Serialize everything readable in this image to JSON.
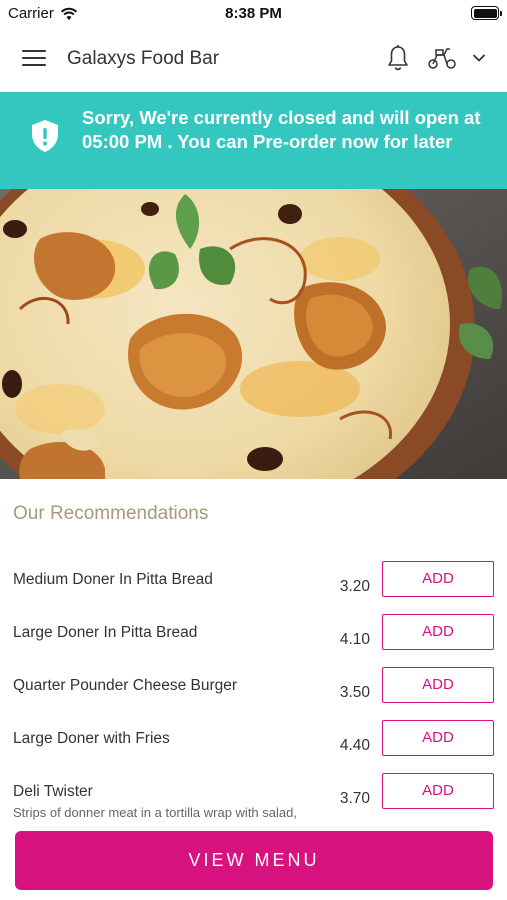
{
  "status_bar": {
    "carrier": "Carrier",
    "time": "8:38 PM"
  },
  "header": {
    "title": "Galaxys Food Bar",
    "icons": [
      "hamburger-menu-icon",
      "bell-icon",
      "scooter-icon",
      "chevron-down-icon"
    ]
  },
  "banner": {
    "message": "Sorry, We're currently closed and will open at 05:00 PM . You can Pre-order now for later",
    "icon": "shield-alert-icon",
    "color": "#33c7c0"
  },
  "recommendations": {
    "title": "Our Recommendations",
    "items": [
      {
        "name": "Medium Doner In Pitta Bread",
        "price": "3.20",
        "button": "ADD"
      },
      {
        "name": "Large Doner In Pitta Bread",
        "price": "4.10",
        "button": "ADD"
      },
      {
        "name": "Quarter Pounder Cheese Burger",
        "price": "3.50",
        "button": "ADD"
      },
      {
        "name": "Large Doner with Fries",
        "price": "4.40",
        "button": "ADD"
      },
      {
        "name": "Deli Twister",
        "description": "Strips of donner meat in a tortilla wrap with salad,",
        "price": "3.70",
        "button": "ADD"
      }
    ]
  },
  "footer": {
    "view_menu_label": "VIEW MENU"
  },
  "colors": {
    "accent": "#d8127f",
    "banner": "#33c7c0",
    "section_title": "#a89a78"
  }
}
